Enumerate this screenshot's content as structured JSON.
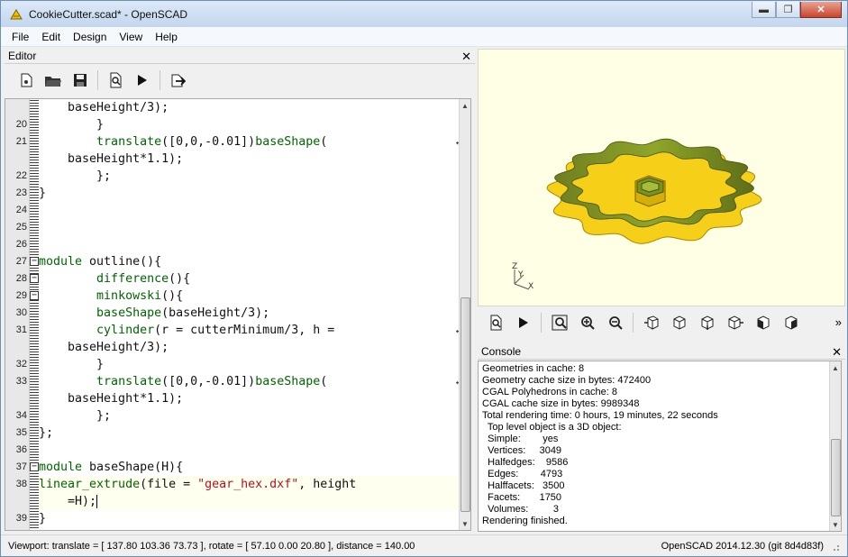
{
  "window": {
    "title": "CookieCutter.scad* - OpenSCAD",
    "minimize": "▬",
    "maximize": "❐",
    "close": "✕"
  },
  "menu": [
    "File",
    "Edit",
    "Design",
    "View",
    "Help"
  ],
  "editor": {
    "title": "Editor",
    "toolbar": [
      "new-file",
      "open-file",
      "save-file",
      "preview-zoom",
      "run",
      "export"
    ],
    "lines": [
      {
        "n": "",
        "t": "    baseHeight/3);"
      },
      {
        "n": "20",
        "t": "        }"
      },
      {
        "n": "21",
        "t": "        translate([0,0,-0.01])baseShape(",
        "wrap": true
      },
      {
        "n": "",
        "t": "    baseHeight*1.1);"
      },
      {
        "n": "22",
        "t": "        };"
      },
      {
        "n": "23",
        "t": "}"
      },
      {
        "n": "24",
        "t": ""
      },
      {
        "n": "25",
        "t": ""
      },
      {
        "n": "26",
        "t": ""
      },
      {
        "n": "27",
        "t": "module outline(){",
        "fold": true,
        "kw": "module"
      },
      {
        "n": "28",
        "t": "        difference(){",
        "fold": true
      },
      {
        "n": "29",
        "t": "        minkowski(){",
        "fold": true
      },
      {
        "n": "30",
        "t": "        baseShape(baseHeight/3);"
      },
      {
        "n": "31",
        "t": "        cylinder(r = cutterMinimum/3, h =",
        "wrap": true
      },
      {
        "n": "",
        "t": "    baseHeight/3);"
      },
      {
        "n": "32",
        "t": "        }"
      },
      {
        "n": "33",
        "t": "        translate([0,0,-0.01])baseShape(",
        "wrap": true
      },
      {
        "n": "",
        "t": "    baseHeight*1.1);"
      },
      {
        "n": "34",
        "t": "        };"
      },
      {
        "n": "35",
        "t": "};"
      },
      {
        "n": "36",
        "t": ""
      },
      {
        "n": "37",
        "t": "module baseShape(H){",
        "fold": true,
        "kw": "module"
      },
      {
        "n": "38",
        "t": "linear_extrude(file = \"gear_hex.dxf\", height",
        "str": "\"gear_hex.dxf\""
      },
      {
        "n": "",
        "t": "    =H);",
        "cursor": true
      },
      {
        "n": "39",
        "t": "}"
      }
    ]
  },
  "viewer": {
    "axis_labels": [
      "Z",
      "Y",
      "X"
    ]
  },
  "view_toolbar": [
    "preview",
    "render",
    "view-all",
    "zoom-in",
    "zoom-out",
    "view-right",
    "view-top",
    "view-bottom",
    "view-left",
    "view-front",
    "view-back"
  ],
  "view_toolbar_more": "»",
  "console": {
    "title": "Console",
    "lines": [
      "Geometries in cache: 8",
      "Geometry cache size in bytes: 472400",
      "CGAL Polyhedrons in cache: 8",
      "CGAL cache size in bytes: 9989348",
      "Total rendering time: 0 hours, 19 minutes, 22 seconds",
      "  Top level object is a 3D object:",
      "  Simple:        yes",
      "  Vertices:     3049",
      "  Halfedges:    9586",
      "  Edges:        4793",
      "  Halffacets:   3500",
      "  Facets:       1750",
      "  Volumes:         3",
      "Rendering finished."
    ]
  },
  "status": {
    "left": "Viewport: translate = [ 137.80 103.36 73.73 ], rotate = [ 57.10 0.00 20.80 ], distance = 140.00",
    "right": "OpenSCAD 2014.12.30 (git 8d4d83f)"
  }
}
